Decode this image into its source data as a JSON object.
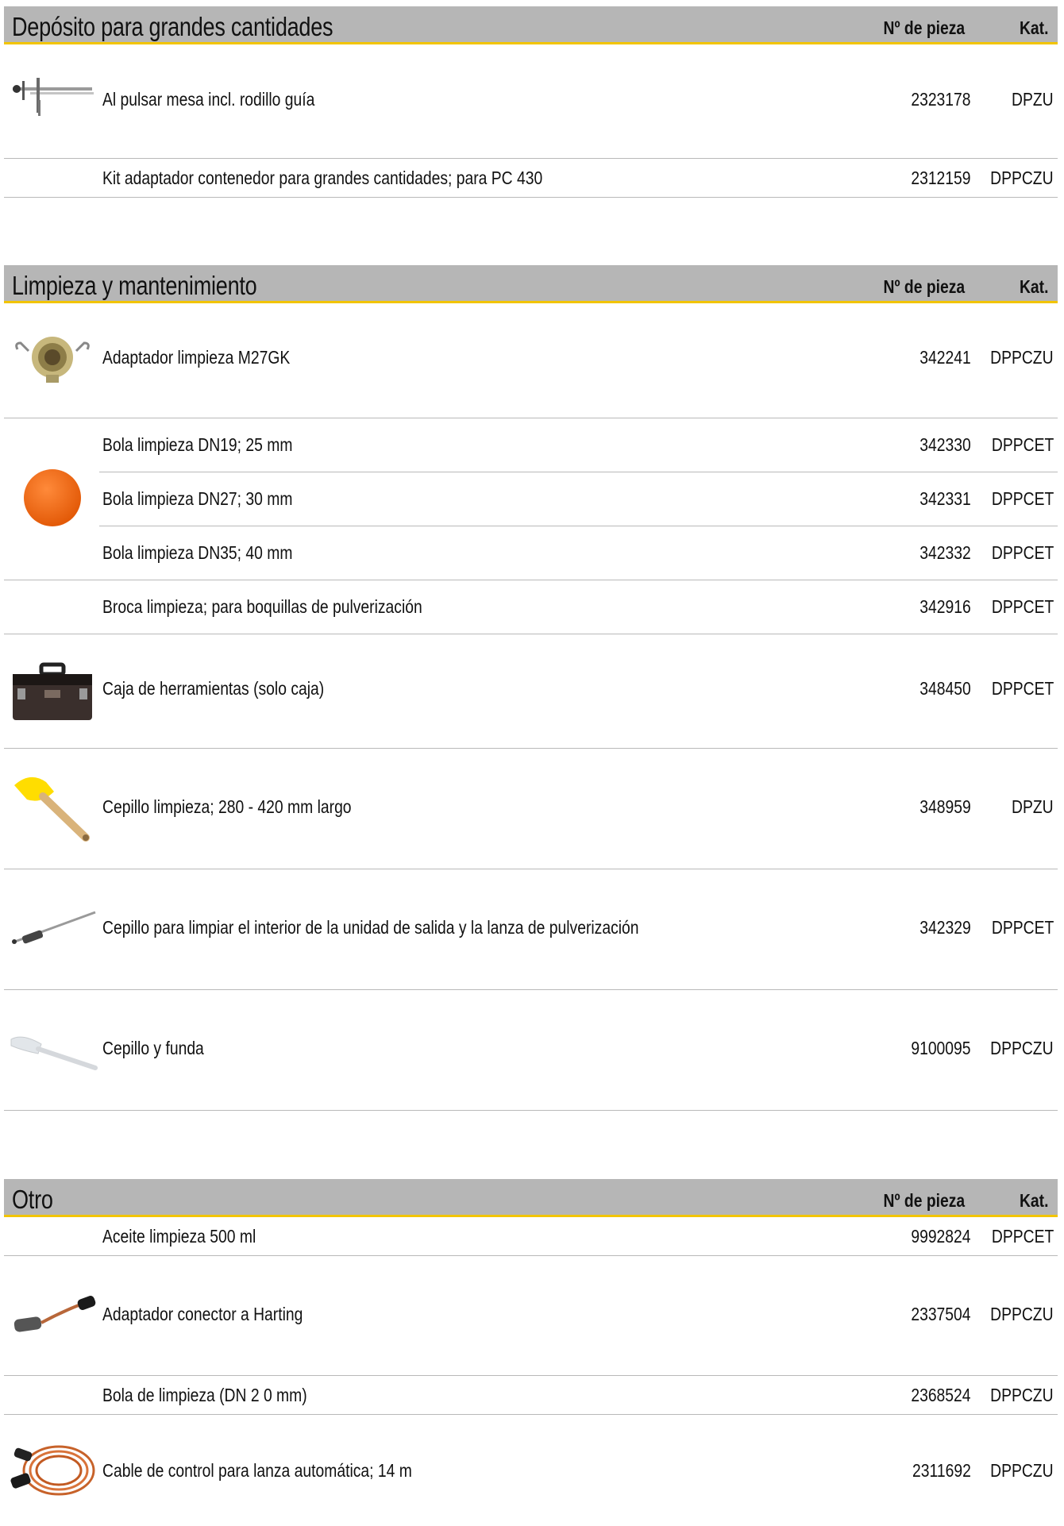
{
  "sections": [
    {
      "title": "Depósito para grandes cantidades",
      "col_num": "Nº de pieza",
      "col_kat": "Kat.",
      "rows": [
        {
          "desc": "Al pulsar mesa incl. rodillo guía",
          "num": "2323178",
          "kat": "DPZU",
          "icon": "table-roller-icon"
        },
        {
          "desc": "Kit adaptador contenedor para grandes cantidades; para PC 430",
          "num": "2312159",
          "kat": "DPPCZU",
          "icon": ""
        }
      ]
    },
    {
      "title": "Limpieza y mantenimiento",
      "col_num": "Nº de pieza",
      "col_kat": "Kat.",
      "rows": [
        {
          "desc": "Adaptador limpieza M27GK",
          "num": "342241",
          "kat": "DPPCZU",
          "icon": "cleaning-adapter-icon"
        },
        {
          "desc": "Bola limpieza DN19; 25 mm",
          "num": "342330",
          "kat": "DPPCET",
          "icon": "cleaning-ball-icon"
        },
        {
          "desc": "Bola limpieza DN27; 30 mm",
          "num": "342331",
          "kat": "DPPCET",
          "icon": ""
        },
        {
          "desc": "Bola limpieza DN35; 40 mm",
          "num": "342332",
          "kat": "DPPCET",
          "icon": ""
        },
        {
          "desc": "Broca limpieza; para boquillas de pulverización",
          "num": "342916",
          "kat": "DPPCET",
          "icon": ""
        },
        {
          "desc": "Caja de herramientas (solo caja)",
          "num": "348450",
          "kat": "DPPCET",
          "icon": "toolbox-icon"
        },
        {
          "desc": "Cepillo limpieza; 280 - 420 mm largo",
          "num": "348959",
          "kat": "DPZU",
          "icon": "brush-icon"
        },
        {
          "desc": "Cepillo para limpiar el interior de la unidad de salida y la lanza de pulverización",
          "num": "342329",
          "kat": "DPPCET",
          "icon": "tube-brush-icon"
        },
        {
          "desc": "Cepillo y funda",
          "num": "9100095",
          "kat": "DPPCZU",
          "icon": "white-brush-icon"
        }
      ]
    },
    {
      "title": "Otro",
      "col_num": "Nº de pieza",
      "col_kat": "Kat.",
      "rows": [
        {
          "desc": "Aceite limpieza 500 ml",
          "num": "9992824",
          "kat": "DPPCET",
          "icon": ""
        },
        {
          "desc": "Adaptador conector a Harting",
          "num": "2337504",
          "kat": "DPPCZU",
          "icon": "connector-adapter-icon"
        },
        {
          "desc": "Bola de limpieza (DN 2 0 mm)",
          "num": "2368524",
          "kat": "DPPCZU",
          "icon": ""
        },
        {
          "desc": "Cable de control para lanza automática; 14 m",
          "num": "2311692",
          "kat": "DPPCZU",
          "icon": "cable-icon"
        }
      ]
    }
  ]
}
